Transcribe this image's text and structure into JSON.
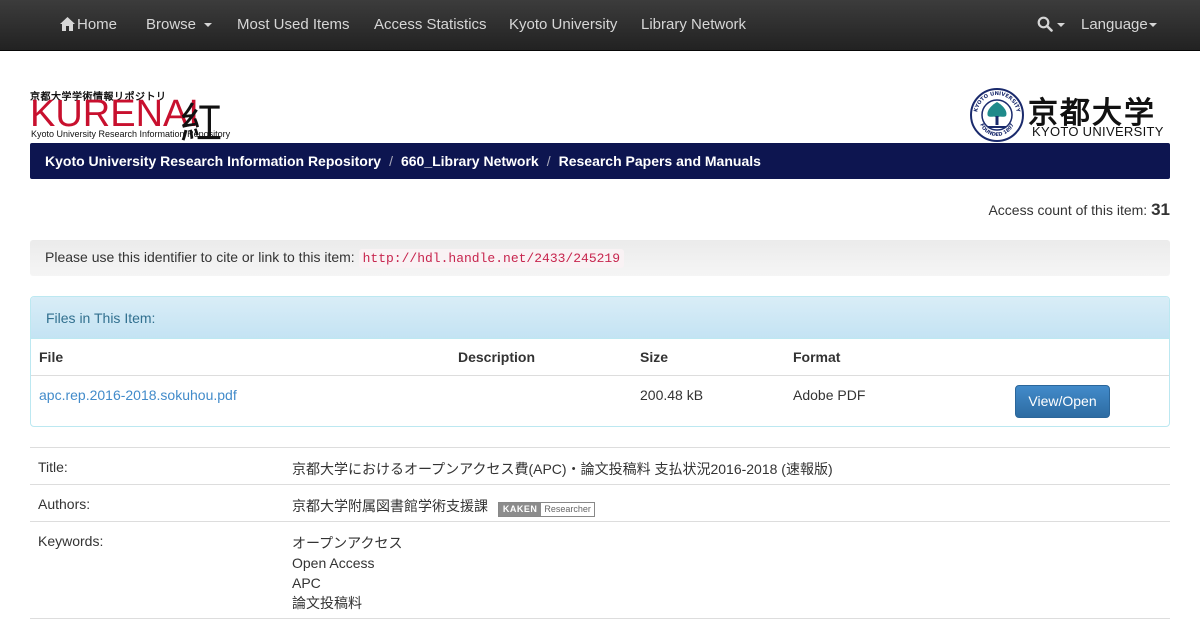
{
  "navbar": {
    "home": "Home",
    "browse": "Browse",
    "most_used": "Most Used Items",
    "access_statistics": "Access Statistics",
    "kyoto_university": "Kyoto University",
    "library_network": "Library Network",
    "language": "Language"
  },
  "header": {
    "logo_small_jp": "京都大学学術情報リポジトリ",
    "logo_big": "KURENAI",
    "logo_kanji": "紅",
    "logo_sub": "Kyoto University Research Information Repository",
    "ku_jp": "京都大学",
    "ku_en": "KYOTO UNIVERSITY",
    "seal_top": "KYOTO UNIVERSITY",
    "seal_bottom": "FOUNDED 1897"
  },
  "breadcrumb": [
    "Kyoto University Research Information Repository",
    "660_Library Network",
    "Research Papers and Manuals"
  ],
  "access": {
    "label": "Access count of this item:",
    "count": "31"
  },
  "identifier": {
    "label": "Please use this identifier to cite or link to this item:",
    "url": "http://hdl.handle.net/2433/245219"
  },
  "files": {
    "heading": "Files in This Item:",
    "columns": [
      "File",
      "Description",
      "Size",
      "Format"
    ],
    "rows": [
      {
        "file": "apc.rep.2016-2018.sokuhou.pdf",
        "description": "",
        "size": "200.48 kB",
        "format": "Adobe PDF",
        "action": "View/Open"
      }
    ]
  },
  "metadata": {
    "title_label": "Title:",
    "title_value": "京都大学におけるオープンアクセス費(APC)・論文投稿料 支払状況2016-2018 (速報版)",
    "authors_label": "Authors:",
    "authors_value": "京都大学附属図書館学術支援課",
    "kaken_a": "KAKEN",
    "kaken_b": "Researcher",
    "keywords_label": "Keywords:",
    "keywords": [
      "オープンアクセス",
      "Open Access",
      "APC",
      "論文投稿料"
    ]
  }
}
